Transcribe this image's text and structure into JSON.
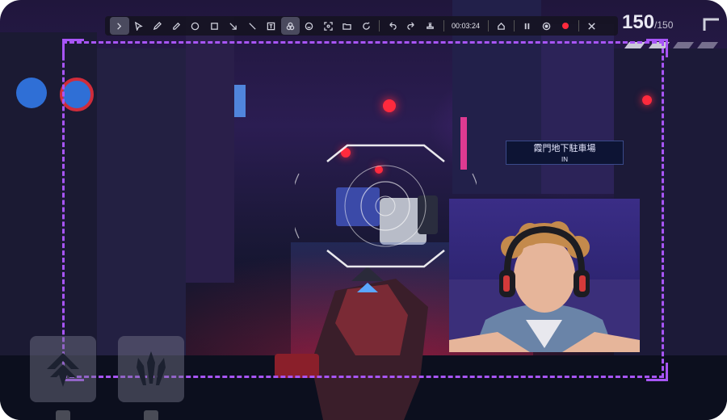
{
  "toolbar": {
    "timer": "00:03:24",
    "tools": [
      "expand-icon",
      "select-icon",
      "pen-icon",
      "pencil-icon",
      "ellipse-icon",
      "rectangle-icon",
      "arrow-icon",
      "line-icon",
      "text-icon",
      "blur-icon",
      "emoji-icon",
      "screenshot-icon",
      "folder-icon",
      "replay-icon",
      "undo-icon",
      "redo-icon",
      "stamp-icon"
    ],
    "controls": [
      "home-icon",
      "pause-icon",
      "record-status-icon",
      "stop-record-icon",
      "close-icon"
    ]
  },
  "ammo": {
    "current": "150",
    "total": "/150"
  },
  "sign": {
    "text": "霞門地下駐車場",
    "sub": "IN"
  },
  "colors": {
    "frame": "#a855f7",
    "record": "#ff2a3d",
    "toolbar_bg": "#16142a"
  },
  "abilities": [
    {
      "name": "dash-ability-icon",
      "key": ""
    },
    {
      "name": "triple-blade-ability-icon",
      "key": ""
    }
  ]
}
